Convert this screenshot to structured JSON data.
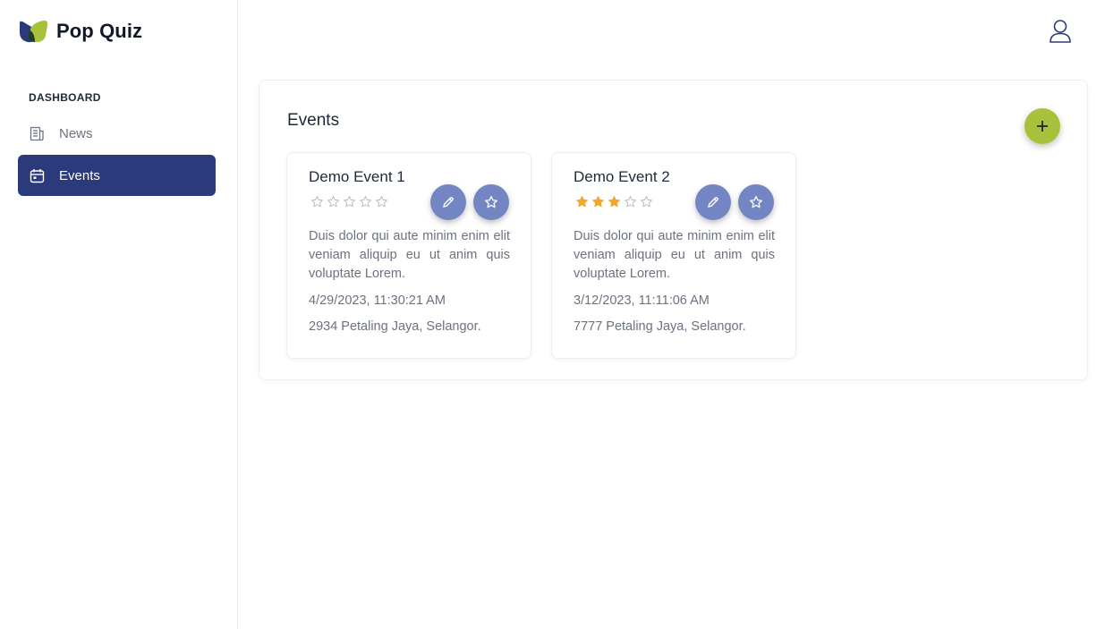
{
  "app": {
    "name": "Pop Quiz",
    "logo_icon": "leaf-logo-icon"
  },
  "sidebar": {
    "section_title": "DASHBOARD",
    "items": [
      {
        "label": "News",
        "icon": "newspaper-icon",
        "active": false
      },
      {
        "label": "Events",
        "icon": "calendar-icon",
        "active": true
      }
    ]
  },
  "header": {
    "user_icon": "user-icon"
  },
  "main": {
    "title": "Events",
    "add_button_icon": "plus-icon",
    "events": [
      {
        "title": "Demo Event 1",
        "rating": 0,
        "max_rating": 5,
        "description": "Duis dolor qui aute minim enim elit veniam aliquip eu ut anim quis voluptate Lorem.",
        "datetime": "4/29/2023, 11:30:21 AM",
        "location": "2934 Petaling Jaya, Selangor."
      },
      {
        "title": "Demo Event 2",
        "rating": 3,
        "max_rating": 5,
        "description": "Duis dolor qui aute minim enim elit veniam aliquip eu ut anim quis voluptate Lorem.",
        "datetime": "3/12/2023, 11:11:06 AM",
        "location": "7777 Petaling Jaya, Selangor."
      }
    ]
  },
  "colors": {
    "primary": "#2a3a7a",
    "accent": "#a8c13a",
    "action_button": "#7385c2",
    "star_filled": "#f5a623",
    "star_empty": "#b8bcc6"
  }
}
